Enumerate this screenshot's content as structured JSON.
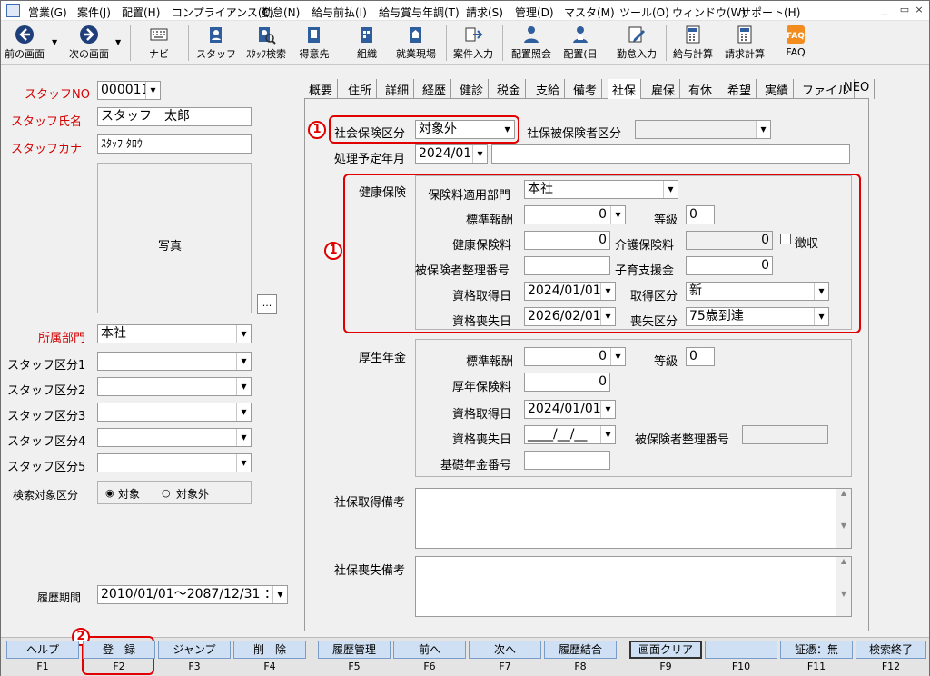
{
  "menubar": {
    "items": [
      "営業(G)",
      "案件(J)",
      "配置(H)",
      "コンプライアンス(C)",
      "勤怠(N)",
      "給与前払(I)",
      "給与賞与年調(T)",
      "請求(S)",
      "管理(D)",
      "マスタ(M)",
      "ツール(O)",
      "ウィンドウ(W)",
      "サポート(H)"
    ],
    "window_buttons": [
      "_",
      "▭",
      "×"
    ]
  },
  "toolbar": {
    "prev": "前の画面",
    "next": "次の画面",
    "navi": "ナビ",
    "staff": "スタッフ",
    "staff_search": "ｽﾀｯﾌ検索",
    "client": "得意先",
    "org": "組織",
    "worksite": "就業現場",
    "case_input": "案件入力",
    "assign_view": "配置照会",
    "assign_day": "配置(日",
    "attendance": "勤怠入力",
    "payroll": "給与計算",
    "billing": "請求計算",
    "faq": "FAQ"
  },
  "left": {
    "staff_no_label": "スタッフNO",
    "staff_no": "000011",
    "staff_name_label": "スタッフ氏名",
    "staff_name": "スタッフ　太郎",
    "staff_kana_label": "スタッフカナ",
    "staff_kana": "ｽﾀｯﾌ ﾀﾛｳ",
    "photo_label": "写真",
    "photo_btn": "...",
    "dept_label": "所属部門",
    "dept": "本社",
    "cat1_label": "スタッフ区分1",
    "cat2_label": "スタッフ区分2",
    "cat3_label": "スタッフ区分3",
    "cat4_label": "スタッフ区分4",
    "cat5_label": "スタッフ区分5",
    "search_target_label": "検索対象区分",
    "radio_target": "対象",
    "radio_nontarget": "対象外",
    "history_label": "履歴期間",
    "history": "2010/01/01～2087/12/31 ："
  },
  "tabs": [
    "概要",
    "住所",
    "詳細",
    "経歴",
    "健診",
    "税金",
    "支給",
    "備考",
    "社保",
    "雇保",
    "有休",
    "希望",
    "実績",
    "ファイル",
    "NEO"
  ],
  "active_tab": "社保",
  "shaho": {
    "insurance_type_label": "社会保険区分",
    "insurance_type": "対象外",
    "insured_type_label": "社保被保険者区分",
    "insured_type": "",
    "process_month_label": "処理予定年月",
    "process_month": "2024/01",
    "process_extra": "",
    "kenpo": {
      "title": "健康保険",
      "dept_label": "保険料適用部門",
      "dept": "本社",
      "std_pay_label": "標準報酬",
      "std_pay": "0",
      "grade_label": "等級",
      "grade": "0",
      "premium_label": "健康保険料",
      "premium": "0",
      "care_label": "介護保険料",
      "care": "0",
      "collect_label": "徴収",
      "insured_no_label": "被保険者整理番号",
      "insured_no": "",
      "child_label": "子育支援金",
      "child": "0",
      "acq_date_label": "資格取得日",
      "acq_date": "2024/01/01",
      "acq_type_label": "取得区分",
      "acq_type": "新",
      "loss_date_label": "資格喪失日",
      "loss_date": "2026/02/01",
      "loss_type_label": "喪失区分",
      "loss_type": "75歳到達"
    },
    "kosei": {
      "title": "厚生年金",
      "std_pay_label": "標準報酬",
      "std_pay": "0",
      "grade_label": "等級",
      "grade": "0",
      "premium_label": "厚年保険料",
      "premium": "0",
      "acq_date_label": "資格取得日",
      "acq_date": "2024/01/01",
      "loss_date_label": "資格喪失日",
      "loss_date": "____/__/__",
      "insured_no_label": "被保険者整理番号",
      "pension_no_label": "基礎年金番号",
      "pension_no": ""
    },
    "acq_memo_label": "社保取得備考",
    "loss_memo_label": "社保喪失備考"
  },
  "annotations": {
    "one": "1",
    "two": "2"
  },
  "fkeys": [
    {
      "label": "ヘルプ",
      "key": "F1"
    },
    {
      "label": "登　録",
      "key": "F2"
    },
    {
      "label": "ジャンプ",
      "key": "F3"
    },
    {
      "label": "削　除",
      "key": "F4"
    },
    {
      "label": "履歴管理",
      "key": "F5"
    },
    {
      "label": "前へ",
      "key": "F6"
    },
    {
      "label": "次へ",
      "key": "F7"
    },
    {
      "label": "履歴結合",
      "key": "F8"
    },
    {
      "label": "画面クリア",
      "key": "F9"
    },
    {
      "label": "",
      "key": "F10"
    },
    {
      "label": "証憑：無",
      "key": "F11"
    },
    {
      "label": "検索終了",
      "key": "F12"
    }
  ]
}
